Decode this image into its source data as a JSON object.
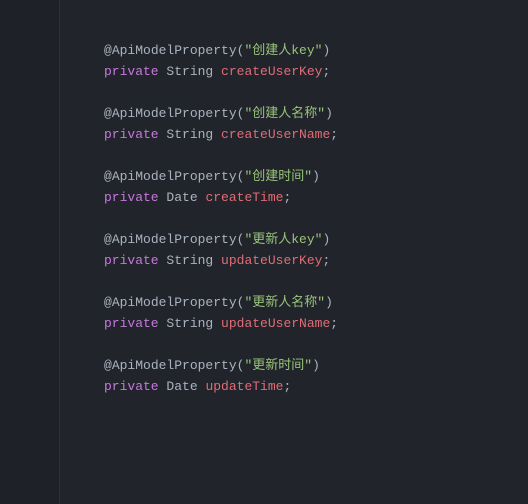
{
  "blocks": [
    {
      "annotation": "@ApiModelProperty",
      "value": "\"创建人key\"",
      "keyword": "private",
      "type": "String",
      "field": "createUserKey"
    },
    {
      "annotation": "@ApiModelProperty",
      "value": "\"创建人名称\"",
      "keyword": "private",
      "type": "String",
      "field": "createUserName"
    },
    {
      "annotation": "@ApiModelProperty",
      "value": "\"创建时间\"",
      "keyword": "private",
      "type": "Date",
      "field": "createTime"
    },
    {
      "annotation": "@ApiModelProperty",
      "value": "\"更新人key\"",
      "keyword": "private",
      "type": "String",
      "field": "updateUserKey"
    },
    {
      "annotation": "@ApiModelProperty",
      "value": "\"更新人名称\"",
      "keyword": "private",
      "type": "String",
      "field": "updateUserName"
    },
    {
      "annotation": "@ApiModelProperty",
      "value": "\"更新时间\"",
      "keyword": "private",
      "type": "Date",
      "field": "updateTime"
    }
  ]
}
